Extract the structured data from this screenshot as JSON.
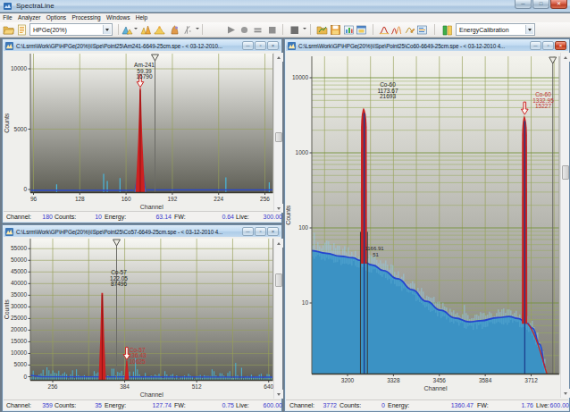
{
  "app": {
    "title": "SpectraLine",
    "window_buttons": {
      "minimize": "minimize",
      "maximize": "maximize",
      "close": "close"
    }
  },
  "menu": {
    "items": [
      "File",
      "Analyzer",
      "Options",
      "Processing",
      "Windows",
      "Help"
    ]
  },
  "toolbar": {
    "detector_combo": "HPGe(20%)",
    "calibration_combo": "EnergyCalibration",
    "icons": [
      "open-folder-icon",
      "report-icon",
      "spectrum-analysis-icon",
      "peak-search-icon",
      "efficiency-icon",
      "nuclide-identify-icon",
      "smoothing-icon",
      "play-icon",
      "record-icon",
      "pause-icon",
      "stop-icon",
      "acquisition-stop-icon",
      "open-spectrum-icon",
      "save-icon",
      "chart-copy-icon",
      "new-window-icon",
      "peak-fit-icon",
      "multi-peak-icon",
      "peak-edit-icon",
      "report-window-icon",
      "library-icon"
    ]
  },
  "windows": [
    {
      "id": "am241",
      "title": "C:\\Lsrm\\Work\\GP\\HPGe(20%)\\!Spe\\Point25\\Am241-6649-25cm.spe - < 03-12-2010...",
      "active": false,
      "buttons": {
        "minimize": "minimize",
        "restore": "restore",
        "close": "close"
      },
      "plot": {
        "type": "linear",
        "xlabel": "Channel",
        "ylabel": "Counts",
        "xticks": [
          96,
          128,
          160,
          192,
          224,
          256
        ],
        "yticks": [
          0,
          5000,
          10000
        ],
        "peaks": [
          {
            "channel": 169.8,
            "amplitude": 8400,
            "nuclide": "Am-241",
            "energy": "59.39",
            "area": "16790",
            "label_color": "black",
            "arrow": true
          }
        ],
        "marker_channel": 180
      },
      "status": [
        {
          "label": "Channel:",
          "value": "180"
        },
        {
          "label": "Counts:",
          "value": "10"
        },
        {
          "label": "Energy:",
          "value": "63.14"
        },
        {
          "label": "FW:",
          "value": "0.64"
        },
        {
          "label": "Live:",
          "value": "300.00"
        }
      ]
    },
    {
      "id": "co57",
      "title": "C:\\Lsrm\\Work\\GP\\HPGe(20%)\\!Spe\\Point25\\Co57-6649-25cm.spe - < 03-12-2010 4...",
      "active": false,
      "buttons": {
        "minimize": "minimize",
        "restore": "restore",
        "close": "close"
      },
      "plot": {
        "type": "linear",
        "xlabel": "Channel",
        "ylabel": "Counts",
        "xticks": [
          256,
          384,
          512,
          640
        ],
        "yticks": [
          0,
          5000,
          10000,
          15000,
          20000,
          25000,
          30000,
          35000,
          40000,
          45000,
          50000,
          55000
        ],
        "peaks": [
          {
            "channel": 344,
            "amplitude": 36000,
            "nuclide": "Co-57",
            "energy": "122.05",
            "area": "87496",
            "label_color": "black",
            "arrow": false
          },
          {
            "channel": 387.7,
            "amplitude": 6900,
            "nuclide": "Co-57",
            "energy": "136.43",
            "area": "10625",
            "label_color": "red",
            "arrow": true
          }
        ],
        "marker_channel": 370
      },
      "status": [
        {
          "label": "Channel:",
          "value": "359"
        },
        {
          "label": "Counts:",
          "value": "35"
        },
        {
          "label": "Energy:",
          "value": "127.74"
        },
        {
          "label": "FW:",
          "value": "0.75"
        },
        {
          "label": "Live:",
          "value": "600.00"
        }
      ]
    },
    {
      "id": "co60",
      "title": "C:\\Lsrm\\Work\\GP\\HPGe(20%)\\!Spe\\Point25\\Co60-6649-25cm.spe - < 03-12-2010 4...",
      "active": true,
      "buttons": {
        "minimize": "minimize",
        "restore": "restore",
        "close": "close"
      },
      "plot": {
        "type": "log",
        "xlabel": "Channel",
        "ylabel": "Counts",
        "xticks": [
          3200,
          3328,
          3456,
          3584,
          3712
        ],
        "yticks": [
          10,
          100,
          1000,
          10000
        ],
        "peaks": [
          {
            "channel": 3246,
            "amplitude": 4000,
            "nuclide": "Co-60",
            "energy": "1173.67",
            "area": "21693",
            "label_color": "black",
            "arrow": false
          },
          {
            "channel": 3694,
            "amplitude": 3150,
            "nuclide": "Co-60",
            "energy": "1332.95",
            "area": "15227",
            "label_color": "red",
            "arrow": true
          }
        ],
        "marker_channel": 3772,
        "roi_label": {
          "line1": "1166.91",
          "line2": "51"
        },
        "continuum": [
          [
            3100,
            50
          ],
          [
            3140,
            46
          ],
          [
            3180,
            42
          ],
          [
            3215,
            40
          ],
          [
            3235,
            37
          ],
          [
            3270,
            32
          ],
          [
            3300,
            27
          ],
          [
            3340,
            21
          ],
          [
            3380,
            15
          ],
          [
            3420,
            10.5
          ],
          [
            3460,
            8
          ],
          [
            3500,
            6.3
          ],
          [
            3540,
            5.6
          ],
          [
            3570,
            5.8
          ],
          [
            3620,
            6.4
          ],
          [
            3650,
            6.6
          ],
          [
            3676,
            6.2
          ],
          [
            3700,
            5.4
          ],
          [
            3716,
            4.6
          ],
          [
            3736,
            2.8
          ],
          [
            3752,
            1.4
          ]
        ]
      },
      "status": [
        {
          "label": "Channel:",
          "value": "3772"
        },
        {
          "label": "Counts:",
          "value": "0"
        },
        {
          "label": "Energy:",
          "value": "1360.47"
        },
        {
          "label": "FW:",
          "value": "1.76"
        },
        {
          "label": "Live:",
          "value": "600.00"
        }
      ]
    }
  ]
}
